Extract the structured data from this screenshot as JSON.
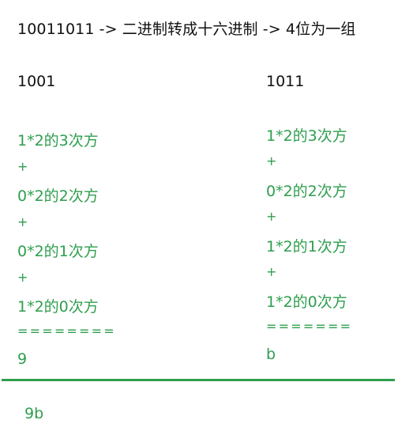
{
  "title": "10011011 -> 二进制转成十六进制 -> 4位为一组",
  "colors": {
    "text": "#111111",
    "accent_green": "#2e9e4e",
    "background": "#ffffff"
  },
  "groups": {
    "left": {
      "label": "1001",
      "steps": {
        "s0": "1*2的3次方",
        "s1": "+",
        "s2": "0*2的2次方",
        "s3": "+",
        "s4": "0*2的1次方",
        "s5": "+",
        "s6": "1*2的0次方",
        "s7": "========",
        "s8": "9"
      }
    },
    "right": {
      "label": "1011",
      "steps": {
        "s0": "1*2的3次方",
        "s1": "+",
        "s2": "0*2的2次方",
        "s3": "+",
        "s4": "1*2的1次方",
        "s5": "+",
        "s6": "1*2的0次方",
        "s7": "=======",
        "s8": "b"
      }
    }
  },
  "result": "9b"
}
